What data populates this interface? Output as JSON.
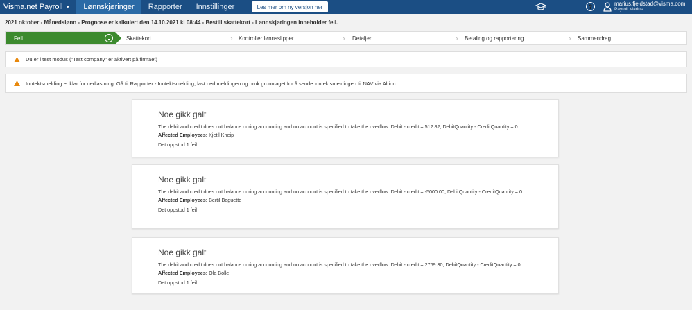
{
  "nav": {
    "brand": "Visma.net Payroll",
    "tabs": [
      "Lønnskjøringer",
      "Rapporter",
      "Innstillinger"
    ],
    "version_button": "Les mer om ny versjon her",
    "help": "?",
    "user_email": "marius.fjeldstad@visma.com",
    "user_name": "Payroll Marius",
    "colors": {
      "bar": "#1b4e84",
      "active_tab": "#2a6aa6"
    }
  },
  "run_title": "2021 oktober - Månedslønn - Prognose er kalkulert den 14.10.2021 kl 08:44 - Bestill skattekort - Lønnskjøringen inneholder feil.",
  "stepper": {
    "active_color": "#3c8a2e",
    "steps": [
      "Feil",
      "Skattekort",
      "Kontroller lønnsslipper",
      "Detaljer",
      "Betaling og rapportering",
      "Sammendrag"
    ]
  },
  "alerts": [
    "Du er i test modus (\"Test company\" er aktivert på firmaet)",
    "Inntektsmelding er klar for nedlastning. Gå til Rapporter - Inntektsmelding, last ned meldingen og bruk grunnlaget for å sende inntektsmeldingen til NAV via Altinn."
  ],
  "errors": [
    {
      "title": "Noe gikk galt",
      "message": "The debit and credit does not balance during accounting and no account is specified to take the overflow. Debit - credit = 512.82, DebitQuantity - CreditQuantity = 0",
      "employees_label": "Affected Employees:",
      "employees": "Kjetil Kneip",
      "count": "Det oppstod 1 feil"
    },
    {
      "title": "Noe gikk galt",
      "message": "The debit and credit does not balance during accounting and no account is specified to take the overflow. Debit - credit = -5000.00, DebitQuantity - CreditQuantity = 0",
      "employees_label": "Affected Employees:",
      "employees": "Bertil Baguette",
      "count": "Det oppstod 1 feil"
    },
    {
      "title": "Noe gikk galt",
      "message": "The debit and credit does not balance during accounting and no account is specified to take the overflow. Debit - credit = 2769.30, DebitQuantity - CreditQuantity = 0",
      "employees_label": "Affected Employees:",
      "employees": "Ola Bolle",
      "count": "Det oppstod 1 feil"
    }
  ]
}
